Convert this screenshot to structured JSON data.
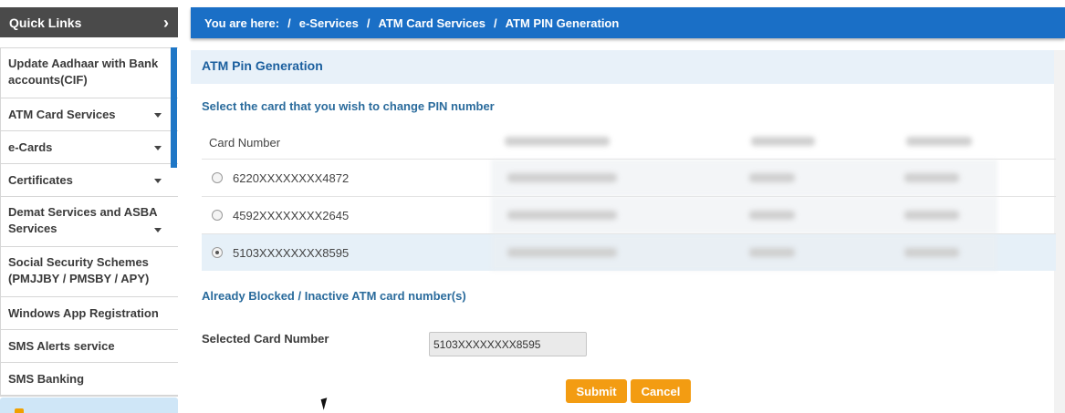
{
  "quick_links": {
    "title": "Quick Links",
    "chevron": "›",
    "items": [
      {
        "label": "Update Aadhaar with Bank accounts(CIF)",
        "has_caret": false
      },
      {
        "label": "ATM Card Services",
        "has_caret": true
      },
      {
        "label": "e-Cards",
        "has_caret": true
      },
      {
        "label": "Certificates",
        "has_caret": true
      },
      {
        "label": "Demat Services and ASBA Services",
        "has_caret": true
      },
      {
        "label": "Social Security Schemes (PMJJBY / PMSBY / APY)",
        "has_caret": false
      },
      {
        "label": "Windows App Registration",
        "has_caret": false
      },
      {
        "label": "SMS Alerts service",
        "has_caret": false
      },
      {
        "label": "SMS Banking",
        "has_caret": false
      }
    ]
  },
  "breadcrumb": {
    "prefix": "You are here:",
    "separator": "/",
    "items": [
      "e-Services",
      "ATM Card Services",
      "ATM PIN Generation"
    ]
  },
  "panel": {
    "title": "ATM Pin Generation",
    "subtitle": "Select the card that you wish to change PIN number",
    "table": {
      "header": "Card Number",
      "rows": [
        {
          "card_number": "6220XXXXXXXX4872",
          "selected": false
        },
        {
          "card_number": "4592XXXXXXXX2645",
          "selected": false
        },
        {
          "card_number": "5103XXXXXXXX8595",
          "selected": true
        }
      ]
    },
    "blocked_link": "Already Blocked / Inactive ATM card number(s)",
    "selected_label": "Selected Card Number",
    "selected_value": "5103XXXXXXXX8595",
    "submit_label": "Submit",
    "cancel_label": "Cancel"
  },
  "colors": {
    "accent_blue": "#1a6fc6",
    "button_orange": "#f39c12",
    "sidebar_header": "#4a4a4a"
  }
}
